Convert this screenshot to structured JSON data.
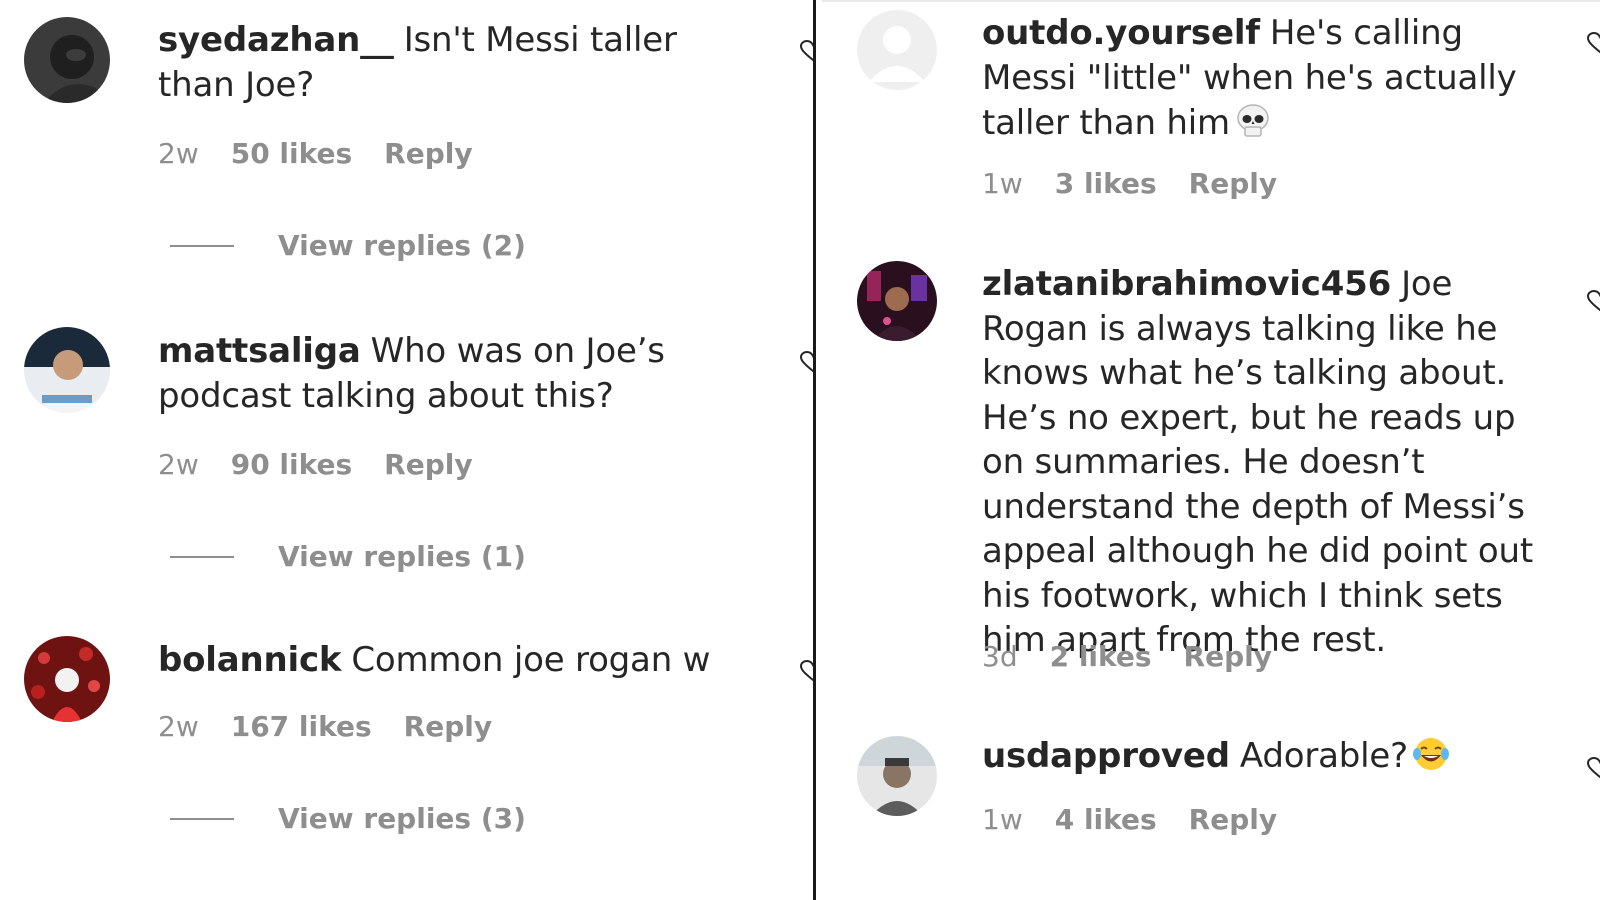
{
  "comments_left": [
    {
      "username": "syedazhan__",
      "text": "Isn't Messi taller than Joe?",
      "age": "2w",
      "likes": "50 likes",
      "reply": "Reply",
      "view_replies": "View replies (2)"
    },
    {
      "username": "mattsaliga",
      "text": "Who was on Joe’s podcast talking about this?",
      "age": "2w",
      "likes": "90 likes",
      "reply": "Reply",
      "view_replies": "View replies (1)"
    },
    {
      "username": "bolannick",
      "text": "Common joe rogan w",
      "age": "2w",
      "likes": "167 likes",
      "reply": "Reply",
      "view_replies": "View replies (3)"
    }
  ],
  "comments_right": [
    {
      "username": "outdo.yourself",
      "text": "He's calling Messi \"little\" when he's actually taller than him",
      "emoji": "skull-emoji",
      "age": "1w",
      "likes": "3 likes",
      "reply": "Reply"
    },
    {
      "username": "zlatanibrahimovic456",
      "text": "Joe Rogan is always talking like he knows what he’s talking about. He’s no expert, but he reads up on summaries. He doesn’t understand the depth of Messi’s appeal although he did point out his footwork, which I think sets him apart from the rest.",
      "age": "3d",
      "likes": "2 likes",
      "reply": "Reply"
    },
    {
      "username": "usdapproved",
      "text": "Adorable?",
      "emoji": "laughing-tears-emoji",
      "age": "1w",
      "likes": "4 likes",
      "reply": "Reply"
    }
  ],
  "icons": {
    "like": "heart-outline-icon",
    "default_avatar": "default-avatar-icon"
  },
  "colors": {
    "text": "#262626",
    "muted": "#8e8e8e",
    "divider": "#1a1a1a"
  }
}
